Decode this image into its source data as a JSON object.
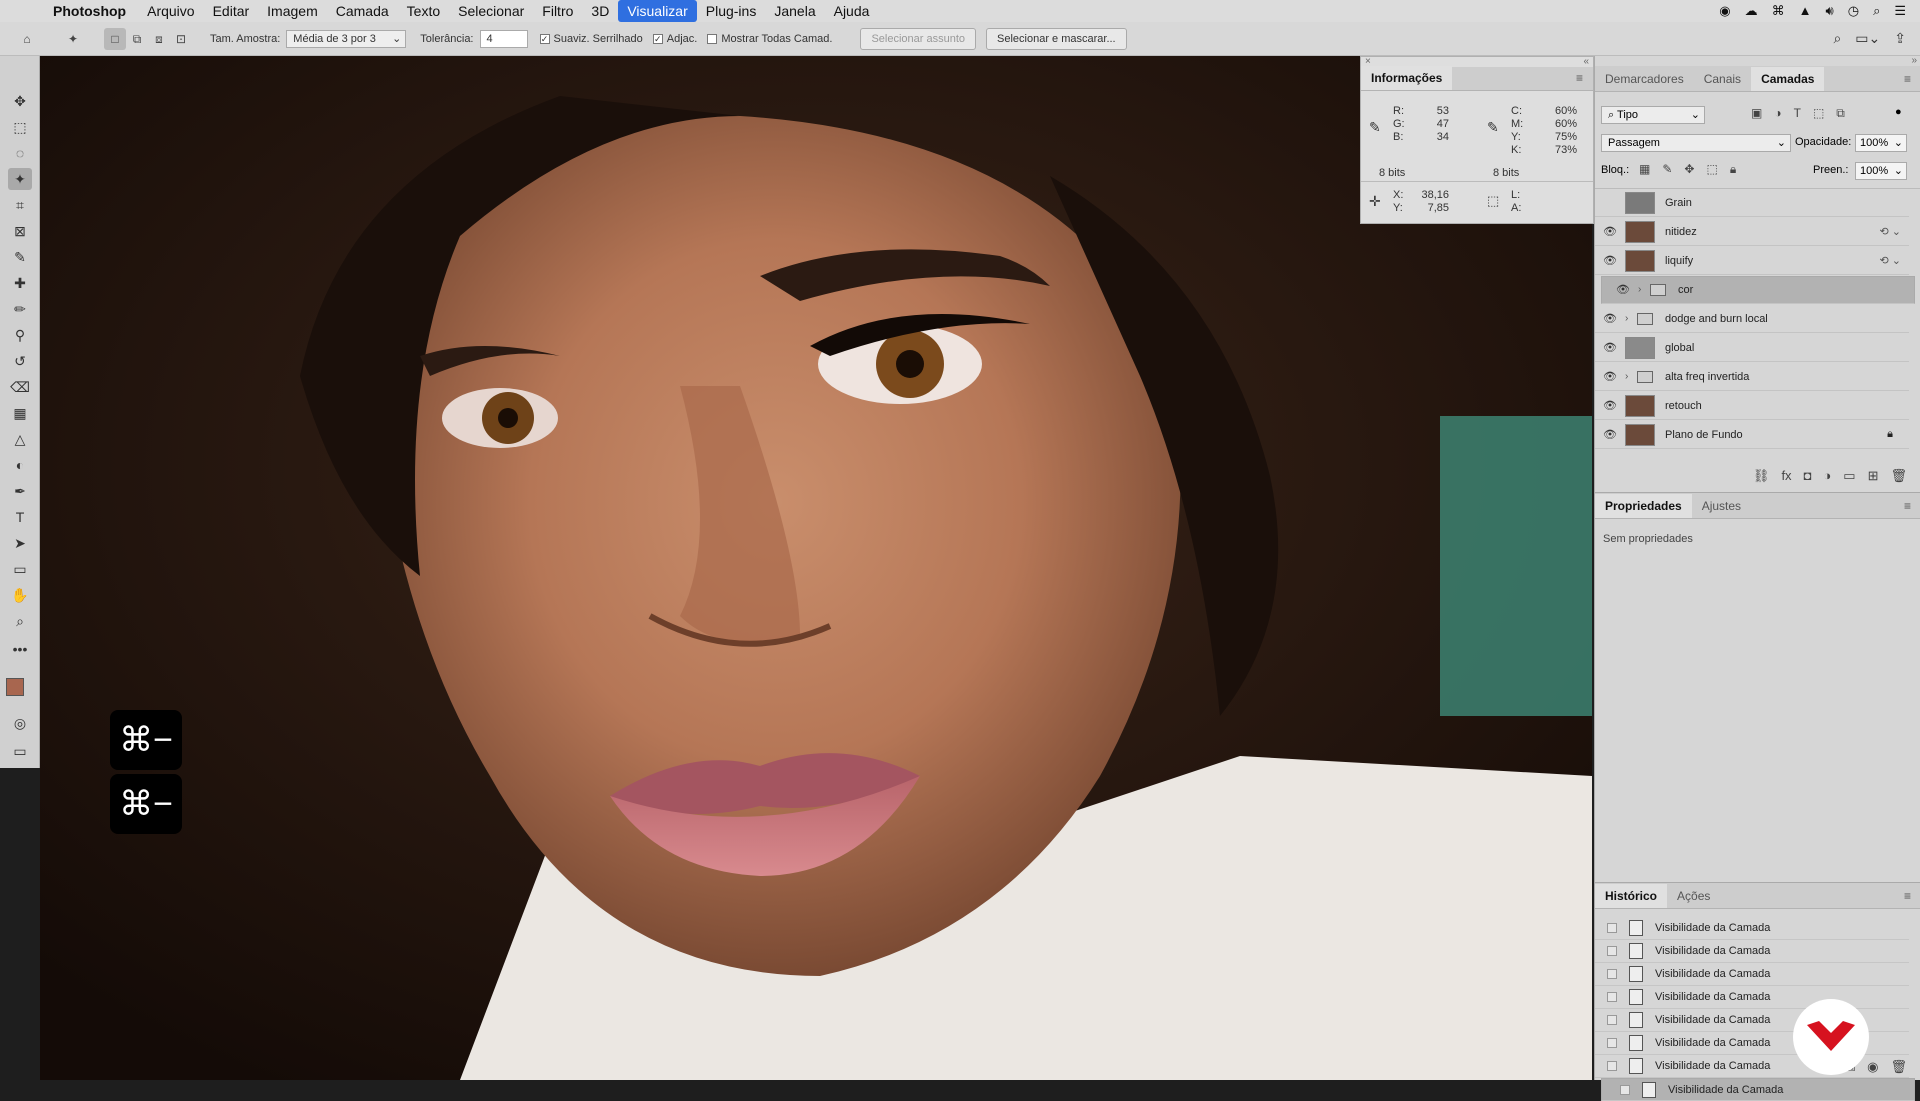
{
  "menubar": {
    "app_name": "Photoshop",
    "items": [
      "Arquivo",
      "Editar",
      "Imagem",
      "Camada",
      "Texto",
      "Selecionar",
      "Filtro",
      "3D",
      "Visualizar",
      "Plug-ins",
      "Janela",
      "Ajuda"
    ],
    "active_index": 8
  },
  "options": {
    "sample_size_label": "Tam. Amostra:",
    "sample_size_value": "Média de 3 por 3",
    "tolerance_label": "Tolerância:",
    "tolerance_value": "4",
    "antialias_label": "Suaviz. Serrilhado",
    "contiguous_label": "Adjac.",
    "all_layers_label": "Mostrar Todas Camad.",
    "select_subject": "Selecionar assunto",
    "select_mask": "Selecionar e mascarar..."
  },
  "shortcut_hint": "⌘−",
  "info": {
    "tab": "Informações",
    "rgb": {
      "R": "53",
      "G": "47",
      "B": "34"
    },
    "cmyk": {
      "C": "60%",
      "M": "60%",
      "Y": "75%",
      "K": "73%"
    },
    "bits_left": "8 bits",
    "bits_right": "8 bits",
    "xy": {
      "X": "38,16",
      "Y": "7,85"
    },
    "la": {
      "L": "",
      "A": ""
    }
  },
  "layers_panel": {
    "tabs": [
      "Demarcadores",
      "Canais",
      "Camadas"
    ],
    "active_tab": 2,
    "filter_value": "Tipo",
    "blend_mode": "Passagem",
    "opacity_label": "Opacidade:",
    "opacity_value": "100%",
    "lock_label": "Bloq.:",
    "fill_label": "Preen.:",
    "fill_value": "100%",
    "layers": [
      {
        "name": "Grain",
        "visible": false,
        "kind": "layer",
        "thumb": "#7a7a7a"
      },
      {
        "name": "nitidez",
        "visible": true,
        "kind": "smart",
        "thumb": "#6b4a3a"
      },
      {
        "name": "liquify",
        "visible": true,
        "kind": "smart",
        "thumb": "#6b4a3a"
      },
      {
        "name": "cor",
        "visible": true,
        "kind": "group",
        "selected": true
      },
      {
        "name": "dodge and burn local",
        "visible": true,
        "kind": "group"
      },
      {
        "name": "global",
        "visible": true,
        "kind": "layer",
        "thumb": "#8a8a8a"
      },
      {
        "name": "alta freq invertida",
        "visible": true,
        "kind": "group"
      },
      {
        "name": "retouch",
        "visible": true,
        "kind": "layer",
        "thumb": "#6b4a3a"
      },
      {
        "name": "Plano de Fundo",
        "visible": true,
        "kind": "locked",
        "thumb": "#6b4a3a"
      }
    ]
  },
  "properties_panel": {
    "tabs": [
      "Propriedades",
      "Ajustes"
    ],
    "empty_text": "Sem propriedades"
  },
  "history_panel": {
    "tabs": [
      "Histórico",
      "Ações"
    ],
    "items": [
      "Visibilidade da Camada",
      "Visibilidade da Camada",
      "Visibilidade da Camada",
      "Visibilidade da Camada",
      "Visibilidade da Camada",
      "Visibilidade da Camada",
      "Visibilidade da Camada",
      "Visibilidade da Camada"
    ]
  },
  "colors": {
    "foreground": "#a8664f",
    "background": "#ffffff",
    "accent": "#2f6fe0",
    "logo_red": "#d6121f"
  }
}
